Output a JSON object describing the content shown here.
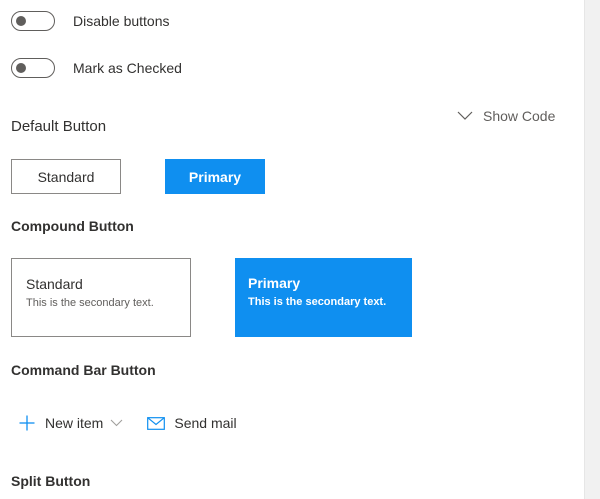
{
  "toggles": [
    {
      "label": "Disable buttons",
      "checked": false
    },
    {
      "label": "Mark as Checked",
      "checked": false
    }
  ],
  "default_button": {
    "title": "Default Button",
    "show_code": "Show Code",
    "standard_label": "Standard",
    "primary_label": "Primary"
  },
  "compound_button": {
    "title": "Compound Button",
    "standard": {
      "label": "Standard",
      "secondary": "This is the secondary text."
    },
    "primary": {
      "label": "Primary",
      "secondary": "This is the secondary text."
    }
  },
  "command_bar_button": {
    "title": "Command Bar Button",
    "new_item_label": "New item",
    "send_mail_label": "Send mail"
  },
  "split_button": {
    "title": "Split Button"
  },
  "colors": {
    "accent": "#0f8ff0",
    "text": "#323130",
    "border": "#8a8886"
  },
  "icons": {
    "show_code": "chevron-down-icon",
    "new_item": "add-icon",
    "new_item_menu": "chevron-down-icon",
    "send_mail": "mail-icon"
  }
}
